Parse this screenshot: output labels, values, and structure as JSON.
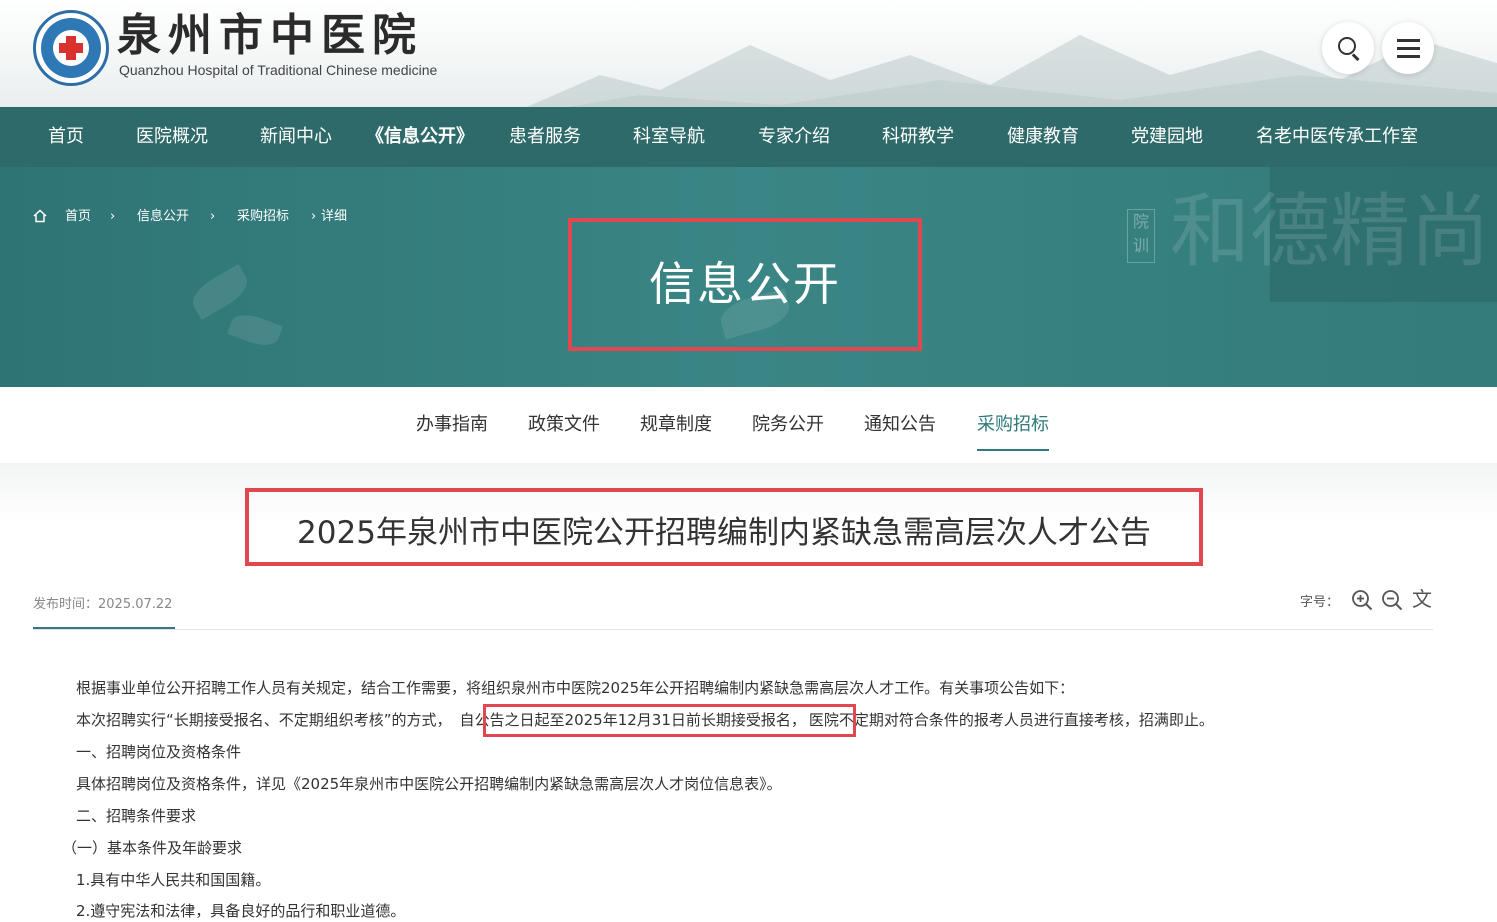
{
  "header": {
    "logo_cn": "泉州市中医院",
    "logo_en": "Quanzhou Hospital of Traditional Chinese medicine"
  },
  "nav": {
    "items": [
      {
        "label": "首页"
      },
      {
        "label": "医院概况"
      },
      {
        "label": "新闻中心"
      },
      {
        "label": "《信息公开》",
        "active": true
      },
      {
        "label": "患者服务"
      },
      {
        "label": "科室导航"
      },
      {
        "label": "专家介绍"
      },
      {
        "label": "科研教学"
      },
      {
        "label": "健康教育"
      },
      {
        "label": "党建园地"
      },
      {
        "label": "名老中医传承工作室"
      }
    ]
  },
  "banner": {
    "title": "信息公开",
    "breadcrumb": [
      "首页",
      "信息公开",
      "采购招标",
      "详细"
    ],
    "seal_text": "院训",
    "calligraphy": "和德精尚"
  },
  "subnav": {
    "items": [
      {
        "label": "办事指南"
      },
      {
        "label": "政策文件"
      },
      {
        "label": "规章制度"
      },
      {
        "label": "院务公开"
      },
      {
        "label": "通知公告"
      },
      {
        "label": "采购招标",
        "active": true
      }
    ]
  },
  "article": {
    "title": "2025年泉州市中医院公开招聘编制内紧缺急需高层次人才公告",
    "publish_label": "发布时间：",
    "publish_date": "2025.07.22",
    "font_size_label": "字号：",
    "paragraphs": [
      "根据事业单位公开招聘工作人员有关规定，结合工作需要，将组织泉州市中医院2025年公开招聘编制内紧缺急需高层次人才工作。有关事项公告如下：",
      "本次招聘实行“长期接受报名、不定期组织考核”的方式，",
      "自公告之日起至2025年12月31日前长期接受报名，",
      "医院不定期对符合条件的报考人员进行直接考核，招满即止。",
      "一、招聘岗位及资格条件",
      "具体招聘岗位及资格条件，详见《2025年泉州市中医院公开招聘编制内紧缺急需高层次人才岗位信息表》。",
      "二、招聘条件要求",
      "（一）基本条件及年龄要求",
      "1.具有中华人民共和国国籍。",
      "2.遵守宪法和法律，具备良好的品行和职业道德。"
    ]
  },
  "colors": {
    "nav_bg": "#2f6a6a",
    "banner_bg": "#3a8585",
    "accent": "#2f7a7a",
    "highlight_border": "#e0474e"
  }
}
